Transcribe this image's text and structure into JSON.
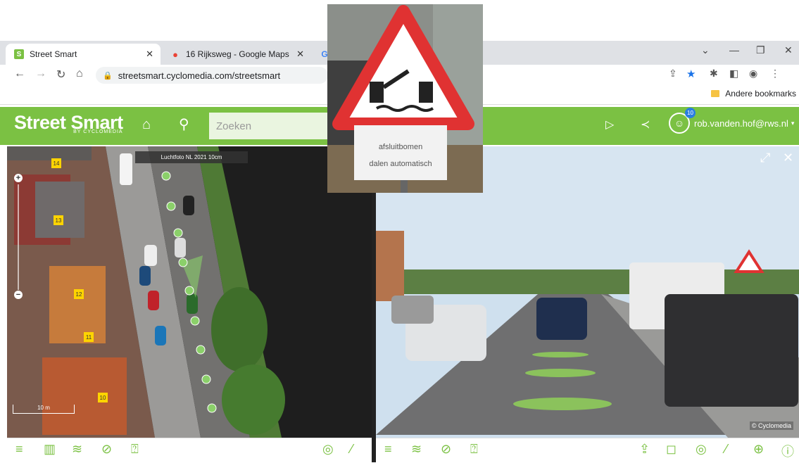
{
  "browser": {
    "tabs": [
      {
        "title": "Street Smart",
        "favicon": "S",
        "favicon_color": "#7bc143"
      },
      {
        "title": "16 Rijksweg - Google Maps",
        "favicon_color": "#34a853"
      },
      {
        "favicon": "G"
      }
    ],
    "url": "streetsmart.cyclomedia.com/streetsmart",
    "bookmark_folder": "Andere bookmarks"
  },
  "app": {
    "logo_main": "Street Smart",
    "logo_sub": "BY CYCLOMEDIA",
    "search_placeholder": "Zoeken",
    "user_email": "rob.vanden.hof@rws.nl",
    "notification_count": "10",
    "accent_color": "#7bc143"
  },
  "map": {
    "layer_label": "Luchtfoto NL 2021 10cm",
    "house_numbers": [
      "14",
      "13",
      "12",
      "11",
      "10"
    ],
    "scale_label": "10 m",
    "zoom_in": "+",
    "zoom_out": "−"
  },
  "panorama": {
    "copyright": "© Cyclomedia"
  },
  "inset_sign": {
    "line1": "afsluitbomen",
    "line2": "dalen automatisch"
  },
  "icons": {
    "home": "home-icon",
    "search": "search-icon",
    "play": "play-icon",
    "share": "share-icon",
    "user": "user-icon",
    "left_tools": [
      "menu-icon",
      "map-icon",
      "layers-icon",
      "hide-icon",
      "report-icon",
      "measure-area-icon",
      "ruler-icon"
    ],
    "right_tools": [
      "menu-icon",
      "layers-icon",
      "hide-icon",
      "report-icon",
      "export-icon",
      "annotate-icon",
      "measure-area-icon",
      "ruler-icon",
      "crosshair-icon",
      "info-icon"
    ]
  }
}
